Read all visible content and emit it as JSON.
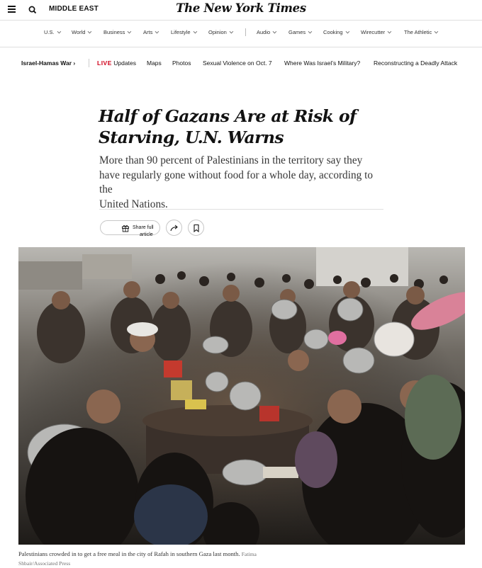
{
  "masthead": {
    "section": "MIDDLE EAST",
    "logo": "The New York Times"
  },
  "section_nav": {
    "items": [
      "U.S.",
      "World",
      "Business",
      "Arts",
      "Lifestyle",
      "Opinion",
      "Audio",
      "Games",
      "Cooking",
      "Wirecutter",
      "The Athletic"
    ]
  },
  "story_nav": {
    "main": "Israel-Hamas War ›",
    "live_tag": "LIVE",
    "live_label": "Updates",
    "items": [
      "Maps",
      "Photos",
      "Sexual Violence on Oct. 7",
      "Where Was Israel’s Military?",
      "Reconstructing a Deadly Attack"
    ]
  },
  "article": {
    "headline_line1": "Half of Gazans Are at Risk of",
    "headline_line2": "Starving, U.N. Warns",
    "summary_line1": "More than 90 percent of Palestinians in the territory say they",
    "summary_line2": "have regularly gone without food for a whole day, according to the",
    "summary_line3": "United Nations.",
    "share_line1": "Share full",
    "share_line2": "article"
  },
  "photo": {
    "caption": "Palestinians crowded in to get a free meal in the city of Rafah in southern Gaza last month.",
    "credit_line1": "Fatima",
    "credit_line2": "Shbair/Associated Press"
  },
  "icons": {
    "menu": "menu-icon",
    "search": "search-icon",
    "gift": "gift-icon",
    "share": "share-arrow-icon",
    "bookmark": "bookmark-icon"
  },
  "colors": {
    "live": "#d0021b",
    "text": "#121212"
  }
}
